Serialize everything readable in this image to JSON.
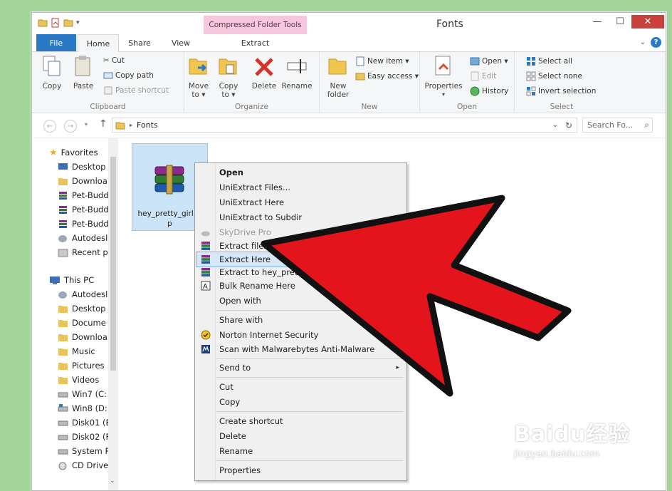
{
  "window": {
    "title": "Fonts",
    "context_tab_group": "Compressed Folder Tools",
    "minimize": "—",
    "maximize": "☐",
    "close": "✕"
  },
  "tabs": [
    {
      "label": "File"
    },
    {
      "label": "Home"
    },
    {
      "label": "Share"
    },
    {
      "label": "View"
    },
    {
      "label": "Extract"
    }
  ],
  "ribbon": {
    "clipboard": {
      "label": "Clipboard",
      "copy": "Copy",
      "paste": "Paste",
      "cut": "Cut",
      "copy_path": "Copy path",
      "paste_shortcut": "Paste shortcut"
    },
    "organize": {
      "label": "Organize",
      "move_to": "Move\nto ▾",
      "copy_to": "Copy\nto ▾",
      "delete": "Delete",
      "rename": "Rename"
    },
    "new": {
      "label": "New",
      "new_folder": "New\nfolder",
      "new_item": "New item ▾",
      "easy_access": "Easy access ▾"
    },
    "open": {
      "label": "Open",
      "properties": "Properties",
      "open": "Open ▾",
      "edit": "Edit",
      "history": "History"
    },
    "select": {
      "label": "Select",
      "select_all": "Select all",
      "select_none": "Select none",
      "invert_selection": "Invert selection"
    }
  },
  "address": {
    "path": "Fonts",
    "search_placeholder": "Search Fo..."
  },
  "nav": {
    "favorites_label": "Favorites",
    "favorites": [
      "Desktop",
      "Downloa",
      "Pet-Budd",
      "Pet-Budd",
      "Pet-Budd",
      "Autodesl",
      "Recent p"
    ],
    "thispc_label": "This PC",
    "thispc": [
      "Autodesl",
      "Desktop",
      "Docume",
      "Downloa",
      "Music",
      "Pictures",
      "Videos",
      "Win7 (C:",
      "Win8 (D:",
      "Disk01 (E",
      "Disk02 (F",
      "System R",
      "CD Drive"
    ]
  },
  "file": {
    "name": "hey_pretty_girl.zip",
    "name_line1": "hey_pretty_girl.zi",
    "name_line2": "p"
  },
  "context_menu": {
    "items": [
      {
        "label": "Open",
        "bold": true
      },
      {
        "label": "UniExtract Files..."
      },
      {
        "label": "UniExtract Here"
      },
      {
        "label": "UniExtract to Subdir"
      },
      {
        "label": "SkyDrive Pro",
        "disabled": true
      },
      {
        "label": "Extract files..."
      },
      {
        "label": "Extract Here",
        "highlighted": true
      },
      {
        "label": "Extract to hey_pretty_girl\\"
      },
      {
        "label": "Bulk Rename Here"
      },
      {
        "label": "Open with"
      },
      {
        "label": "Share with"
      },
      {
        "label": "Norton Internet Security"
      },
      {
        "label": "Scan with Malwarebytes Anti-Malware"
      },
      {
        "label": "Send to"
      },
      {
        "label": "Cut"
      },
      {
        "label": "Copy"
      },
      {
        "label": "Create shortcut"
      },
      {
        "label": "Delete"
      },
      {
        "label": "Rename"
      },
      {
        "label": "Properties"
      }
    ]
  },
  "watermark": {
    "brand": "Baidu经验",
    "url": "jingyan.baidu.com"
  },
  "colors": {
    "accent": "#2a79c7",
    "context_tab": "#f7c7de",
    "selection": "#cce4f7",
    "arrow": "#e3141c",
    "background": "#a3d49a"
  }
}
